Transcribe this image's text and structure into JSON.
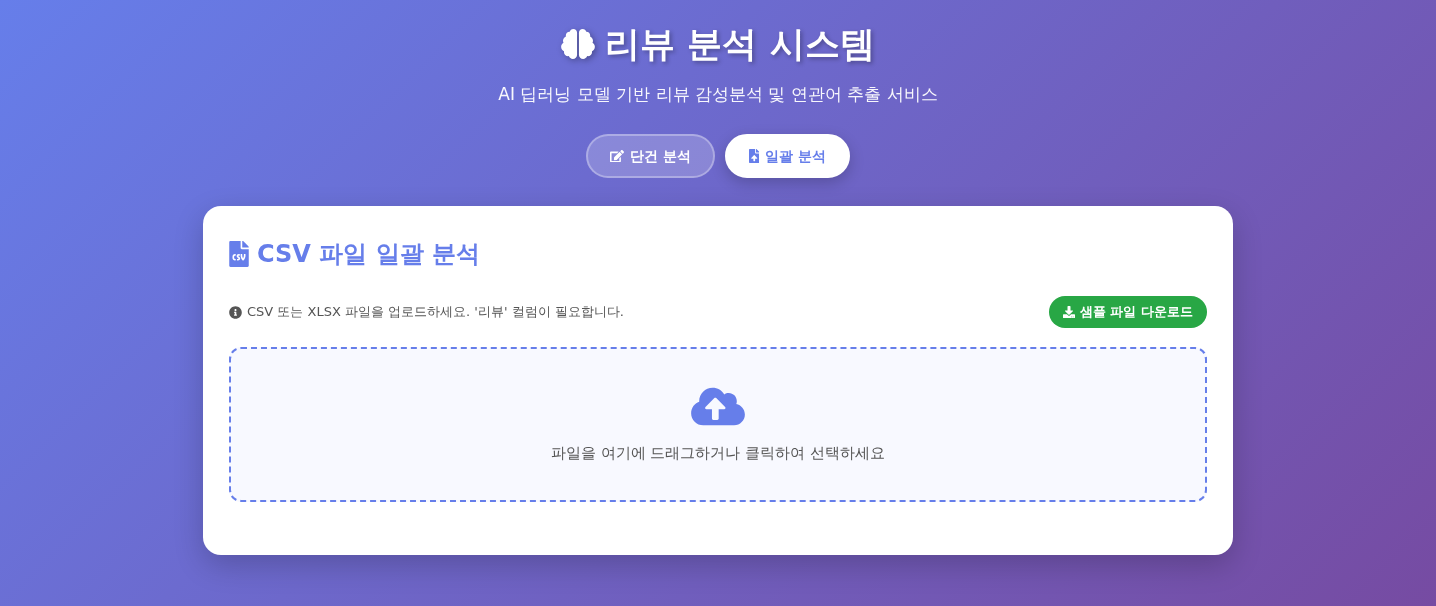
{
  "header": {
    "title": "리뷰 분석 시스템",
    "subtitle": "AI 딥러닝 모델 기반 리뷰 감성분석 및 연관어 추출 서비스"
  },
  "tabs": [
    {
      "label": "단건 분석",
      "kind": "edit",
      "selected": false
    },
    {
      "label": "일괄 분석",
      "kind": "upload",
      "selected": true
    }
  ],
  "panel": {
    "title": "CSV 파일 일괄 분석",
    "notice": "CSV 또는 XLSX 파일을 업로드하세요. '리뷰' 컬럼이 필요합니다.",
    "download_button": "샘플 파일 다운로드",
    "dropzone": {
      "label": "파일을 여기에 드래그하거나 클릭하여 선택하세요"
    }
  }
}
